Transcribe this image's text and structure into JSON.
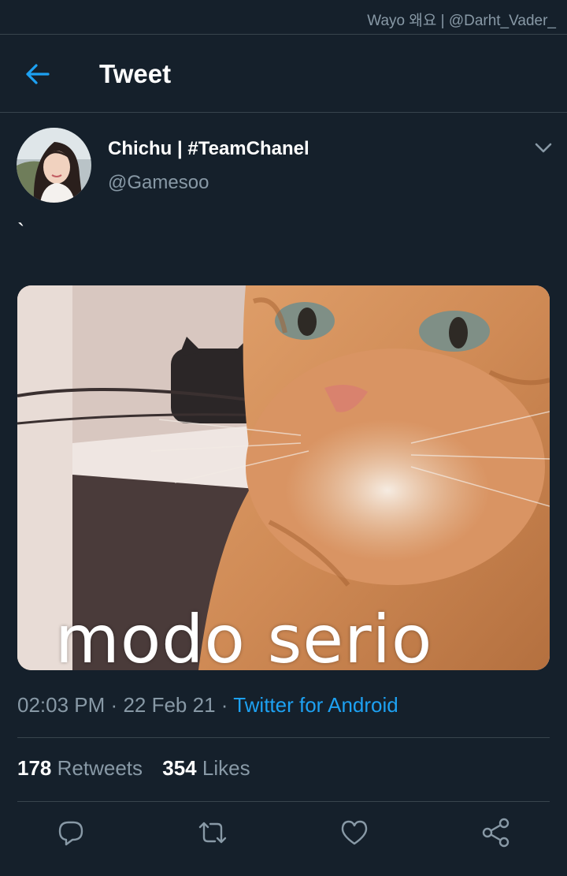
{
  "watermark": "Wayo 왜요 | @Darht_Vader_",
  "header": {
    "title": "Tweet"
  },
  "tweet": {
    "display_name": "Chichu | #TeamChanel",
    "handle": "@Gamesoo",
    "text": "`",
    "media_caption": "modo serio",
    "time": "02:03 PM",
    "date": "22 Feb 21",
    "separator": "·",
    "source": "Twitter for Android",
    "retweets_count": "178",
    "retweets_label": "Retweets",
    "likes_count": "354",
    "likes_label": "Likes"
  },
  "icons": {
    "back": "arrow-left-icon",
    "more": "chevron-down-icon",
    "reply": "reply-icon",
    "retweet": "retweet-icon",
    "like": "heart-icon",
    "share": "share-icon"
  },
  "colors": {
    "background": "#15202b",
    "accent": "#1da1f2",
    "secondary_text": "#8899a6",
    "divider": "#38444d"
  }
}
